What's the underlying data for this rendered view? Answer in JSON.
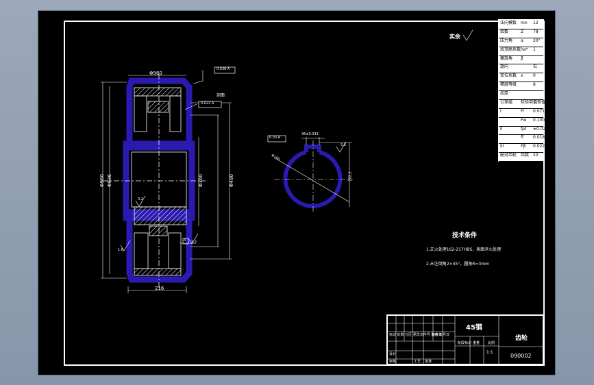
{
  "surface_note": "实余",
  "param_table": {
    "rows": [
      {
        "label": "法向模数",
        "sym": "mn",
        "val": "12"
      },
      {
        "label": "齿数",
        "sym": "Z",
        "val": "78"
      },
      {
        "label": "压力角",
        "sym": "α",
        "val": "20°"
      },
      {
        "label": "齿顶高系数",
        "sym": "ha*",
        "val": "1"
      },
      {
        "label": "螺旋角",
        "sym": "β",
        "val": ""
      },
      {
        "label": "旋向",
        "sym": "",
        "val": "右"
      },
      {
        "label": "变位系数",
        "sym": "x",
        "val": "0"
      },
      {
        "label": "精度等级",
        "sym": "",
        "val": "8"
      },
      {
        "label": "齿厚",
        "sym": "",
        "val": ""
      },
      {
        "label": "公差组",
        "sym": "检验项目",
        "val": "公差值"
      },
      {
        "label": "I",
        "sym": "Fr",
        "val": "0.071"
      },
      {
        "label": "",
        "sym": "Fw",
        "val": "0.100"
      },
      {
        "label": "II",
        "sym": "fpt",
        "val": "±0.020"
      },
      {
        "label": "",
        "sym": "ff",
        "val": "0.018"
      },
      {
        "label": "III",
        "sym": "Fβ",
        "val": "0.022"
      },
      {
        "label": "配对齿轮",
        "sym": "齿数",
        "val": "20"
      }
    ]
  },
  "tech_req": {
    "title": "技术条件",
    "items": [
      "1.正火处理162-217HBS，表面淬火处理",
      "2.未注倒角2×45°，圆角R=3mm"
    ]
  },
  "title_block": {
    "material": "45钢",
    "part_name": "齿轮",
    "drawing_no": "090002",
    "scale": "1:1",
    "scale_header": "比例",
    "stage_label": "阶段标记",
    "weight_label": "重量",
    "designer_label": "设计",
    "checker_label": "审核",
    "approve_label": "批准",
    "std_label": "标准化",
    "process_label": "工艺",
    "revision_header": "标记 处数 分区 更改文件号 签名 年月日"
  },
  "dimensions": {
    "top_width": "Φ960",
    "face_width": "216",
    "od": "Φ960",
    "pitch_d": "Φ936",
    "bore_side": "Φ360",
    "hub_d": "Φ480",
    "roughness_a": "3.2",
    "roughness_b": "1.6",
    "roughness_c": "3.2",
    "chamfer": "2×45°",
    "datum": "A",
    "tol_frame_top": "0.038 A",
    "tol_frame_mid": "0.022 A",
    "section_label": "剖面",
    "key_width": "36±0.031",
    "key_depth": "202.2",
    "bore_dia": "Φ180",
    "bore_tol_frame": "0.03 A",
    "roughness_key": "3.2"
  }
}
